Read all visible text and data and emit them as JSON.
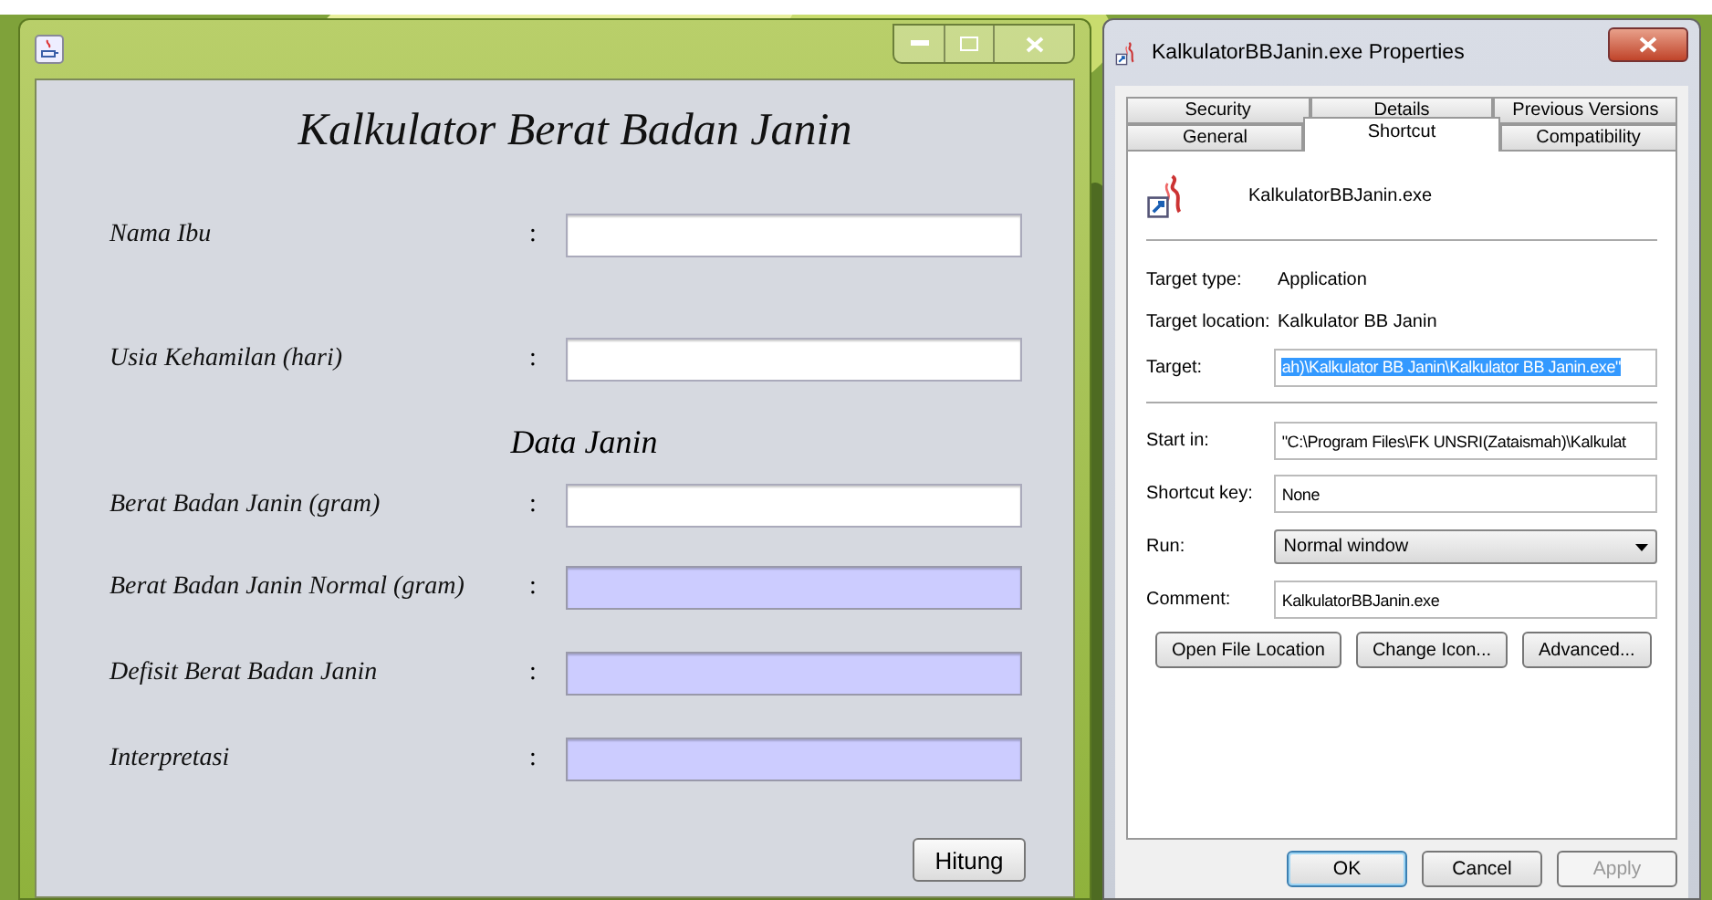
{
  "calculator": {
    "title": "Kalkulator Berat Badan Janin",
    "rows": [
      {
        "kind": "field",
        "label": "Nama Ibu",
        "colon": ":",
        "editable": true
      },
      {
        "kind": "field",
        "label": "Usia Kehamilan (hari)",
        "colon": ":",
        "editable": true
      },
      {
        "kind": "heading",
        "label": "Data Janin"
      },
      {
        "kind": "field",
        "label": "Berat Badan Janin (gram)",
        "colon": ":",
        "editable": true
      },
      {
        "kind": "field",
        "label": "Berat Badan Janin Normal (gram)",
        "colon": ":",
        "editable": false
      },
      {
        "kind": "field",
        "label": "Defisit Berat Badan Janin",
        "colon": ":",
        "editable": false
      },
      {
        "kind": "field",
        "label": "Interpretasi",
        "colon": ":",
        "editable": false
      }
    ],
    "button": "Hitung"
  },
  "properties": {
    "title": "KalkulatorBBJanin.exe Properties",
    "tab_rows": [
      [
        {
          "label": "Security",
          "selected": false
        },
        {
          "label": "Details",
          "selected": false
        },
        {
          "label": "Previous Versions",
          "selected": false
        }
      ],
      [
        {
          "label": "General",
          "selected": false
        },
        {
          "label": "Shortcut",
          "selected": true
        },
        {
          "label": "Compatibility",
          "selected": false
        }
      ]
    ],
    "file_name": "KalkulatorBBJanin.exe",
    "info": [
      {
        "label": "Target type:",
        "value": "Application"
      },
      {
        "label": "Target location:",
        "value": "Kalkulator BB Janin"
      }
    ],
    "target": {
      "label": "Target:",
      "value": "ah)\\Kalkulator BB Janin\\Kalkulator BB Janin.exe\"",
      "highlighted": true
    },
    "fields": [
      {
        "kind": "text",
        "label": "Start in:",
        "value": "\"C:\\Program Files\\FK UNSRI(Zataismah)\\Kalkulat"
      },
      {
        "kind": "text",
        "label": "Shortcut key:",
        "value": "None"
      },
      {
        "kind": "select",
        "label": "Run:",
        "value": "Normal window"
      },
      {
        "kind": "text",
        "label": "Comment:",
        "value": "KalkulatorBBJanin.exe"
      }
    ],
    "actions": [
      "Open File Location",
      "Change Icon...",
      "Advanced..."
    ],
    "buttons": [
      {
        "label": "OK",
        "default": true,
        "disabled": false
      },
      {
        "label": "Cancel",
        "default": false,
        "disabled": false
      },
      {
        "label": "Apply",
        "default": false,
        "disabled": true
      }
    ]
  }
}
